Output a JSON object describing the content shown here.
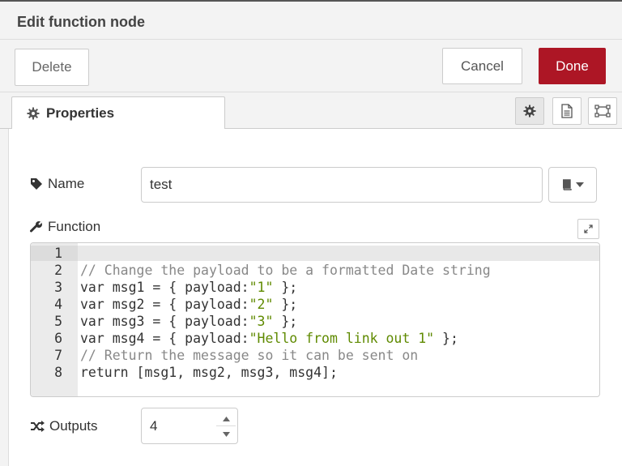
{
  "header": {
    "title": "Edit function node"
  },
  "toolbar": {
    "delete_label": "Delete",
    "cancel_label": "Cancel",
    "done_label": "Done"
  },
  "tabs": {
    "properties_label": "Properties",
    "icons": [
      "gear-icon",
      "description-icon",
      "appearance-icon"
    ]
  },
  "form": {
    "name_label": "Name",
    "name_value": "test",
    "function_label": "Function",
    "outputs_label": "Outputs",
    "outputs_value": "4"
  },
  "editor": {
    "lines": [
      {
        "n": "1",
        "parts": []
      },
      {
        "n": "2",
        "parts": [
          {
            "t": "// Change the payload to be a formatted Date string",
            "c": "cmt"
          }
        ]
      },
      {
        "n": "3",
        "parts": [
          {
            "t": "var msg1 = { payload:",
            "c": ""
          },
          {
            "t": "\"1\"",
            "c": "str"
          },
          {
            "t": " };",
            "c": ""
          }
        ]
      },
      {
        "n": "4",
        "parts": [
          {
            "t": "var msg2 = { payload:",
            "c": ""
          },
          {
            "t": "\"2\"",
            "c": "str"
          },
          {
            "t": " };",
            "c": ""
          }
        ]
      },
      {
        "n": "5",
        "parts": [
          {
            "t": "var msg3 = { payload:",
            "c": ""
          },
          {
            "t": "\"3\"",
            "c": "str"
          },
          {
            "t": " };",
            "c": ""
          }
        ]
      },
      {
        "n": "6",
        "parts": [
          {
            "t": "var msg4 = { payload:",
            "c": ""
          },
          {
            "t": "\"Hello from link out 1\"",
            "c": "str"
          },
          {
            "t": " };",
            "c": ""
          }
        ]
      },
      {
        "n": "7",
        "parts": [
          {
            "t": "// Return the message so it can be sent on",
            "c": "cmt"
          }
        ]
      },
      {
        "n": "8",
        "parts": [
          {
            "t": "return [msg1, msg2, msg3, msg4];",
            "c": ""
          }
        ]
      }
    ]
  },
  "colors": {
    "done": "#ad1625",
    "string": "#5f8a00",
    "comment": "#888888"
  }
}
